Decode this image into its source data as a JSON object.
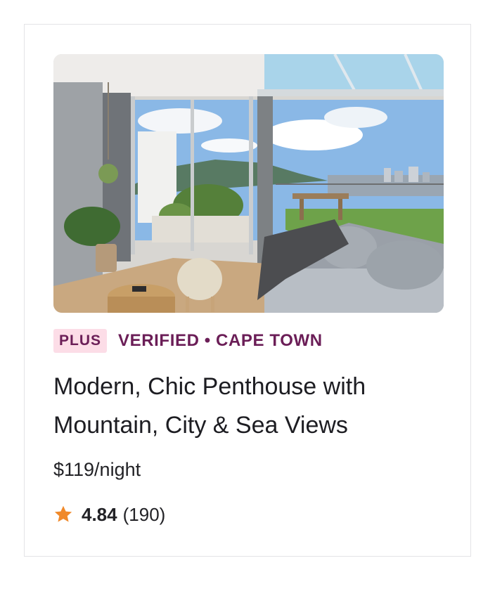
{
  "listing": {
    "badge": "PLUS",
    "meta": "VERIFIED • CAPE TOWN",
    "title": "Modern, Chic Penthouse with Mountain, City & Sea Views",
    "price": "$119/night",
    "rating": "4.84",
    "review_count": "(190)",
    "photo_icon": "penthouse-living-room-photo",
    "star_icon": "star-icon"
  },
  "colors": {
    "accent": "#6b1e57",
    "badge_bg": "#fcdde7",
    "star": "#f0892a",
    "text": "#1d1d22"
  }
}
